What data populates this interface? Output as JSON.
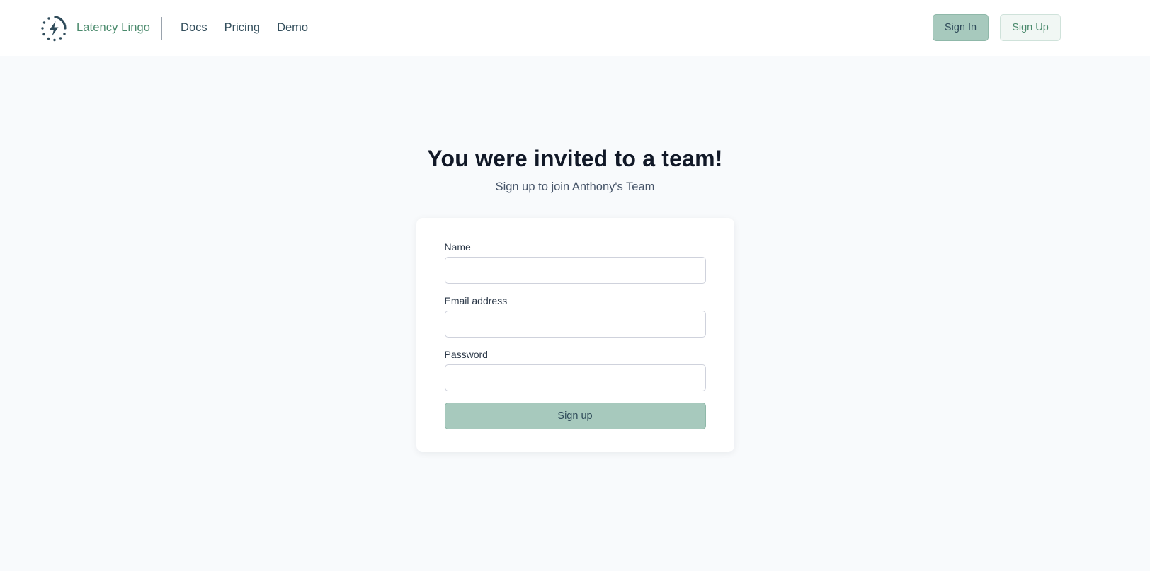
{
  "header": {
    "brand_name": "Latency Lingo",
    "brand_icon": "lightning-dotted-circle-icon",
    "nav": [
      {
        "label": "Docs"
      },
      {
        "label": "Pricing"
      },
      {
        "label": "Demo"
      }
    ],
    "sign_in_label": "Sign In",
    "sign_up_label": "Sign Up"
  },
  "main": {
    "title": "You were invited to a team!",
    "subtitle": "Sign up to join Anthony's Team",
    "form": {
      "fields": [
        {
          "label": "Name",
          "value": "",
          "placeholder": ""
        },
        {
          "label": "Email address",
          "value": "",
          "placeholder": ""
        },
        {
          "label": "Password",
          "value": "",
          "placeholder": ""
        }
      ],
      "submit_label": "Sign up"
    }
  },
  "colors": {
    "brand_green": "#4a8a6c",
    "button_fill": "#a7c9bd",
    "page_bg": "#f8fafc",
    "title_text": "#111827"
  }
}
